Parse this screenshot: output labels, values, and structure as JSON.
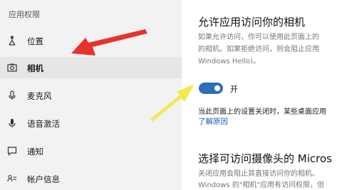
{
  "sidebar": {
    "section_title": "应用权限",
    "items": [
      {
        "label": "位置",
        "icon": "location-icon"
      },
      {
        "label": "相机",
        "icon": "camera-icon"
      },
      {
        "label": "麦克风",
        "icon": "microphone-icon"
      },
      {
        "label": "语音激活",
        "icon": "voice-activation-icon"
      },
      {
        "label": "通知",
        "icon": "notification-icon"
      },
      {
        "label": "帐户信息",
        "icon": "account-info-icon"
      }
    ],
    "active_item": "相机"
  },
  "main": {
    "title": "允许应用访问你的相机",
    "desc_lines": [
      "如果允许访问，你可以使用此页面上的",
      "的相机。如果拒绝访问，则会阻止应用",
      "Windows Hello)。"
    ],
    "toggle": {
      "label": "开",
      "state": "on"
    },
    "status_text": "当此页面上的设置关闭时，某些桌面应用",
    "link_text": "了解原因",
    "section2_title": "选择可访问摄像头的 Micros",
    "section2_desc_lines": [
      "关闭应用会阻止其直接访问你的相机。",
      "Windows 的\"相机\"应用有访问权限，但"
    ]
  },
  "colors": {
    "sidebar_bg": "#f2f2f2",
    "toggle_on": "#2e6fb7",
    "link": "#1a5fb4",
    "arrow_red": "#e8322d",
    "arrow_yellow": "#f2e94e"
  }
}
